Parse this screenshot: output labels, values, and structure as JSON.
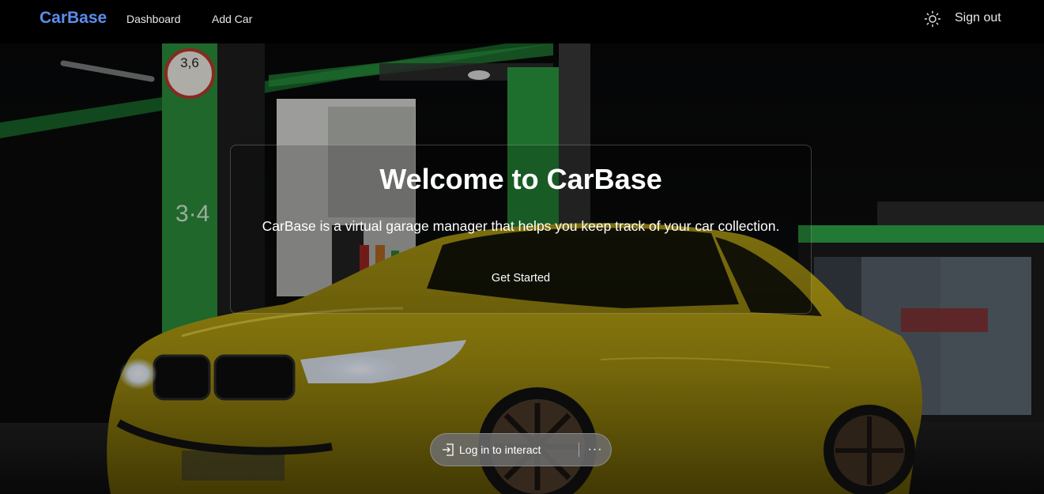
{
  "nav": {
    "brand": "CarBase",
    "links": [
      {
        "label": "Dashboard"
      },
      {
        "label": "Add Car"
      }
    ],
    "theme_icon": "sun-icon",
    "sign_out": "Sign out"
  },
  "hero": {
    "title": "Welcome to CarBase",
    "description": "CarBase is a virtual garage manager that helps you keep track of your car collection.",
    "cta": "Get Started",
    "background": "night gas station with yellow car"
  },
  "login_pill": {
    "label": "Log in to interact",
    "login_icon": "sign-in-icon",
    "more_icon": "more-icon",
    "more_glyph": "···"
  },
  "colors": {
    "brand": "#5b8def",
    "navbar": "#000000",
    "car": "#b8a410",
    "station_green": "#2ea84a"
  }
}
